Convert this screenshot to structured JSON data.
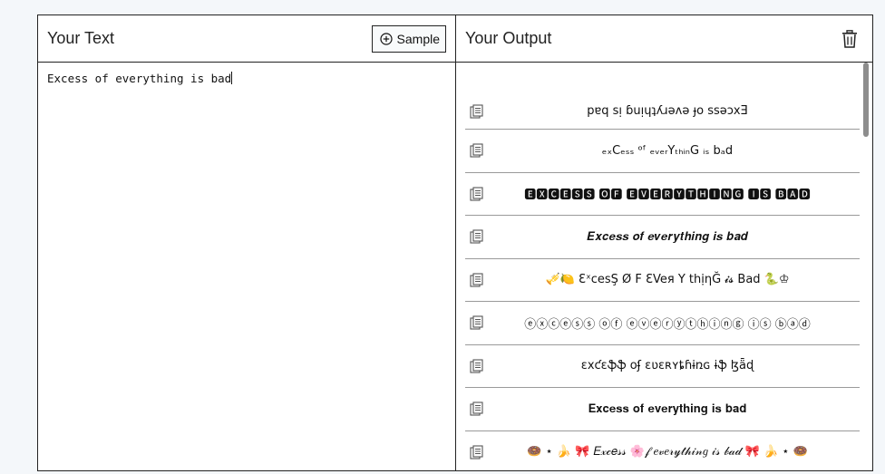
{
  "input_panel": {
    "title": "Your Text",
    "sample_button_label": "Sample",
    "text": "Excess of everything is bad"
  },
  "output_panel": {
    "title": "Your Output",
    "items": [
      "pɐq sᴉ ɓuᴉɥʇʎɹǝʌǝ ɟo ssǝɔxƎ",
      "ₑₓCₑₛₛ ᵒᶠ ₑᵥₑᵣYₜₕᵢₙG ᵢₛ bₐd",
      "🅴🆇🅲🅴🆂🆂 🅾🅵 🅴🆅🅴🆁🆈🆃🅷🅸🅽🅶 🅸🆂 🅱🅰🅳",
      "𝑬𝒙𝒄𝒆𝒔𝒔 𝒐𝒇 𝒆𝒗𝒆𝒓𝒚𝒕𝒉𝒊𝒏𝒈 𝒊𝒔 𝒃𝒂𝒅",
      "🎺🍋 ƐˣcesŞ Ø F  ƐVeя Y thịηĞ 𝓲𝓼 Bad 🐍♔",
      "ⓔⓧⓒⓔⓢⓢ ⓞⓕ ⓔⓥⓔⓡⓨⓣⓗⓘⓝⓖ ⓘⓢ ⓑⓐⓓ",
      "ɛxƈɛֆֆ օʄ ɛʋɛʀʏȶɦɨռɢ ɨֆ ɮǟɖ",
      "𝐄𝐱𝐜𝐞𝐬𝐬 𝐨𝐟 𝐞𝐯𝐞𝐫𝐲𝐭𝐡𝐢𝐧𝐠 𝐢𝐬 𝐛𝐚𝐝",
      "🍩 ⋆ 🍌 🎀 𝐸𝓍𝒸𝑒𝓈𝓈 🌸𝒻 𝑒𝓋𝑒𝓇𝓎𝓉𝒽𝒾𝓃𝑔 𝒾𝓈 𝒷𝒶𝒹 🎀 🍌 ⋆ 🍩"
    ]
  },
  "icons": {
    "sample": "plus-circle-icon",
    "clear": "trash-icon",
    "copy": "copy-icon"
  }
}
